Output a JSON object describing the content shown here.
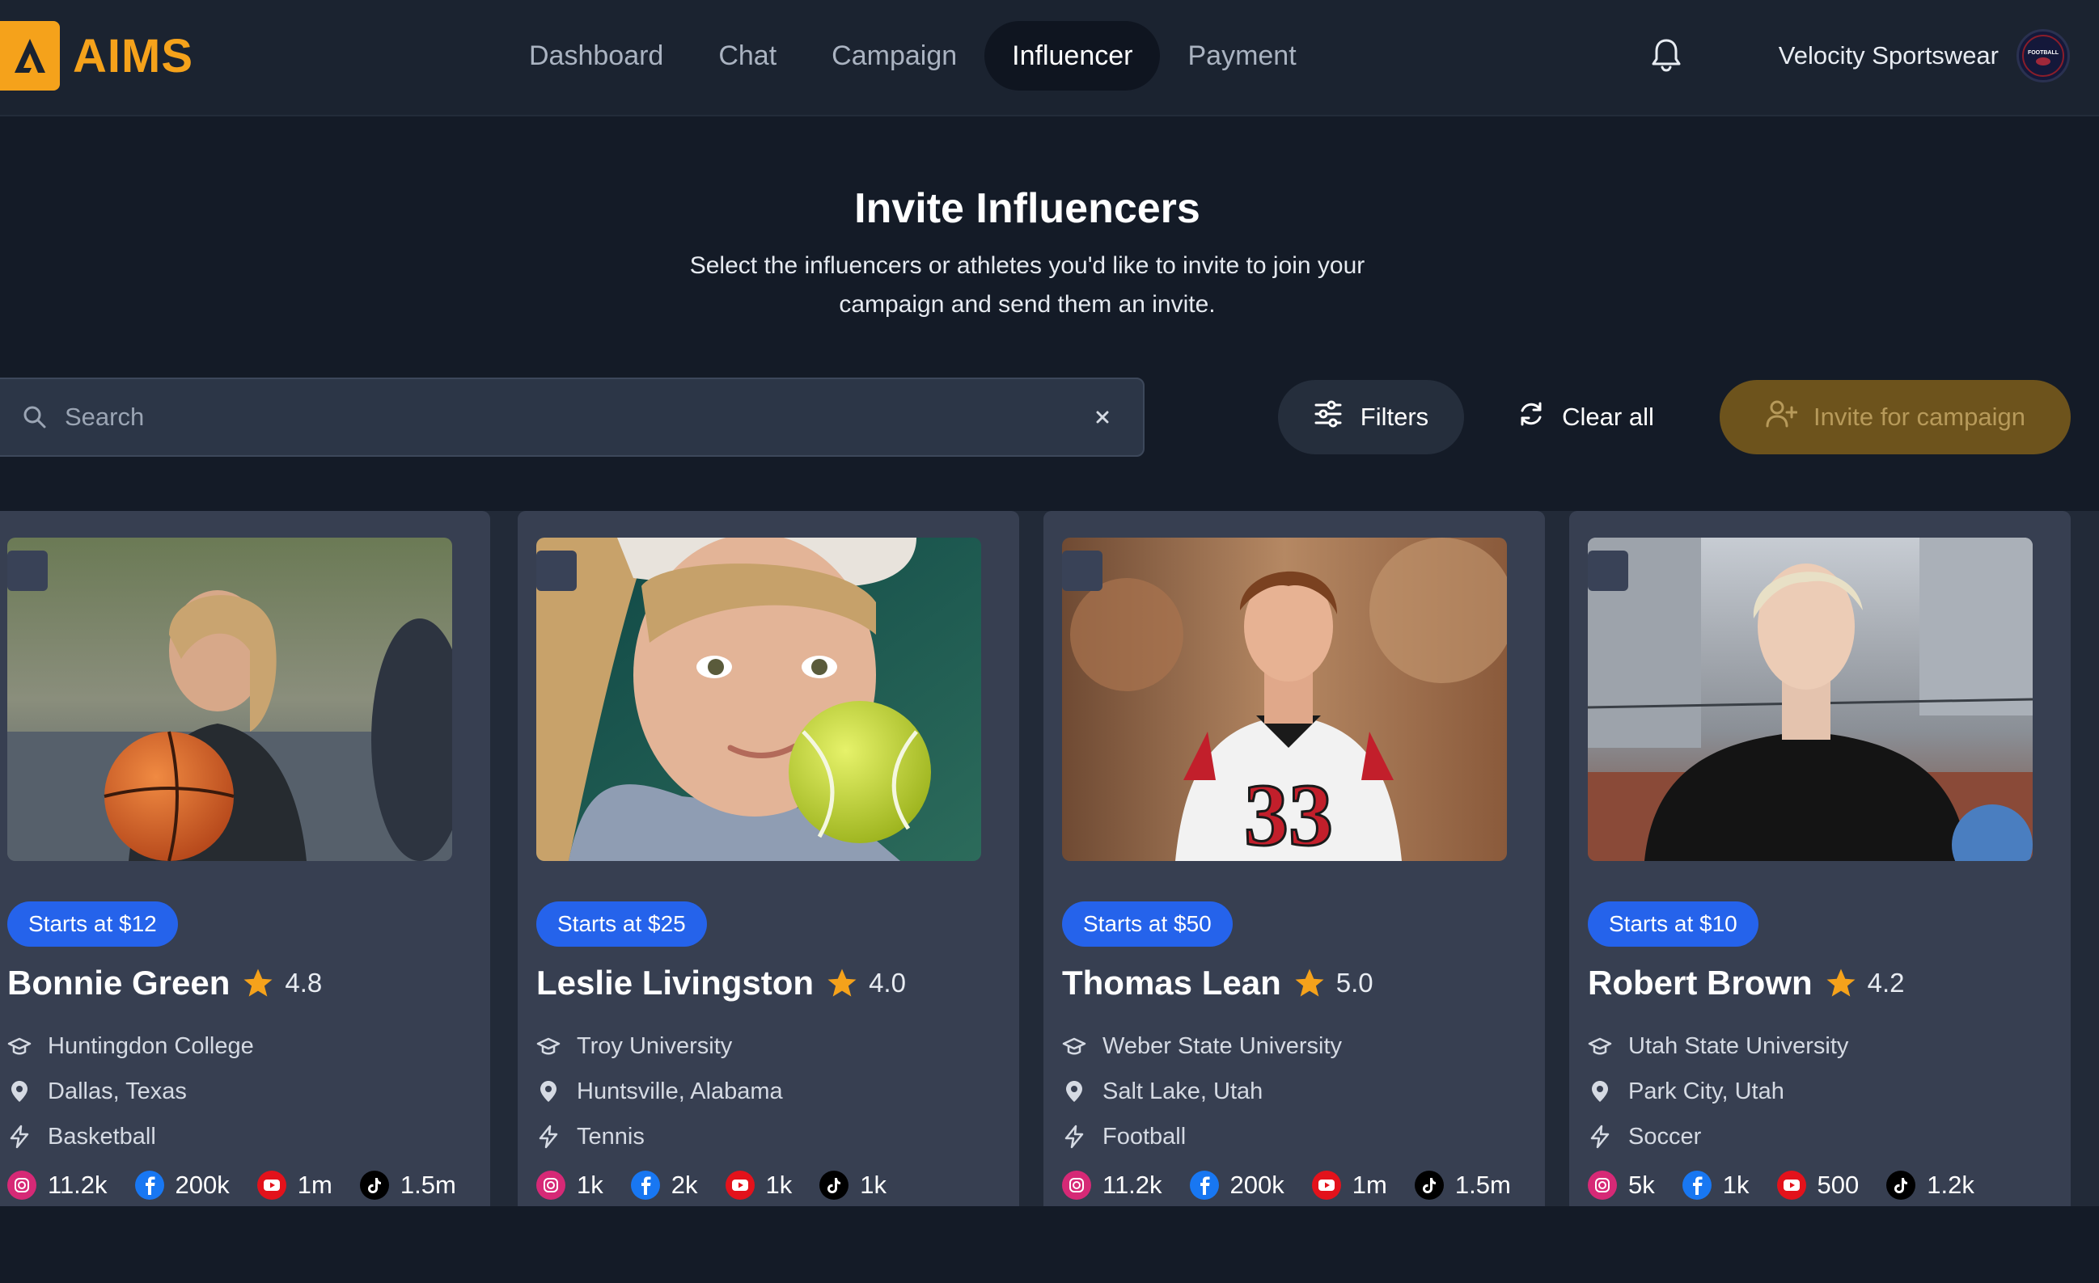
{
  "brand": {
    "name": "AIMS",
    "accent": "#f5a21b"
  },
  "nav": {
    "items": [
      {
        "label": "Dashboard",
        "active": false
      },
      {
        "label": "Chat",
        "active": false
      },
      {
        "label": "Campaign",
        "active": false
      },
      {
        "label": "Influencer",
        "active": true
      },
      {
        "label": "Payment",
        "active": false
      }
    ]
  },
  "account": {
    "name": "Velocity Sportswear",
    "avatar_text": "FOOTBALL"
  },
  "hero": {
    "title": "Invite Influencers",
    "subtitle": "Select the influencers or athletes you'd like to invite to join your campaign and send them an invite."
  },
  "search": {
    "placeholder": "Search",
    "value": ""
  },
  "toolbar": {
    "filters_label": "Filters",
    "clear_label": "Clear all",
    "invite_label": "Invite for campaign"
  },
  "influencers": [
    {
      "price": "Starts at $12",
      "name": "Bonnie Green",
      "rating": "4.8",
      "school": "Huntingdon College",
      "location": "Dallas, Texas",
      "sport": "Basketball",
      "instagram": "11.2k",
      "facebook": "200k",
      "youtube": "1m",
      "tiktok": "1.5m"
    },
    {
      "price": "Starts at $25",
      "name": "Leslie Livingston",
      "rating": "4.0",
      "school": "Troy University",
      "location": "Huntsville, Alabama",
      "sport": "Tennis",
      "instagram": "1k",
      "facebook": "2k",
      "youtube": "1k",
      "tiktok": "1k"
    },
    {
      "price": "Starts at $50",
      "name": "Thomas Lean",
      "rating": "5.0",
      "school": "Weber State University",
      "location": "Salt Lake, Utah",
      "sport": "Football",
      "instagram": "11.2k",
      "facebook": "200k",
      "youtube": "1m",
      "tiktok": "1.5m"
    },
    {
      "price": "Starts at $10",
      "name": "Robert Brown",
      "rating": "4.2",
      "school": "Utah State University",
      "location": "Park City, Utah",
      "sport": "Soccer",
      "instagram": "5k",
      "facebook": "1k",
      "youtube": "500",
      "tiktok": "1.2k"
    }
  ],
  "colors": {
    "background": "#141b27",
    "card": "#373f51",
    "price_badge": "#2563eb",
    "star": "#f5a21b",
    "invite_button": "#6d531c"
  }
}
